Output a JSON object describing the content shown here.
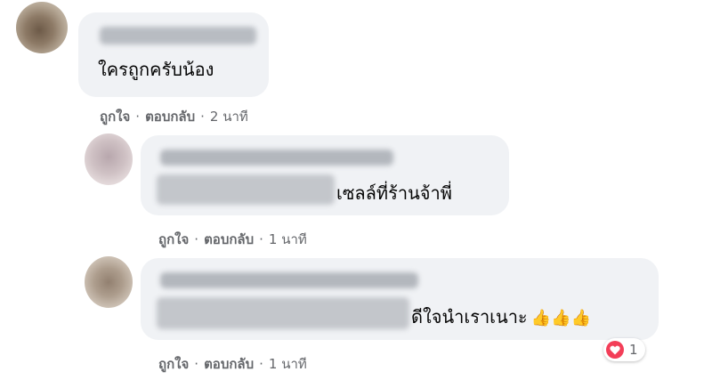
{
  "comments": [
    {
      "text": "ใครถูกครับน้อง",
      "actions": {
        "like": "ถูกใจ",
        "reply": "ตอบกลับ",
        "time": "2 นาที"
      }
    },
    {
      "text": "เซลล์ที่ร้านจ้าพี่",
      "actions": {
        "like": "ถูกใจ",
        "reply": "ตอบกลับ",
        "time": "1 นาที"
      }
    },
    {
      "text": "ดีใจนำเราเนาะ",
      "emoji": "👍👍👍",
      "actions": {
        "like": "ถูกใจ",
        "reply": "ตอบกลับ",
        "time": "1 นาที"
      },
      "reaction": {
        "icon": "heart-icon",
        "count": "1",
        "color": "#f33e58"
      }
    }
  ],
  "separator": "·",
  "colors": {
    "bubble": "#f0f2f5",
    "action_text": "#65676b",
    "text": "#050505"
  }
}
